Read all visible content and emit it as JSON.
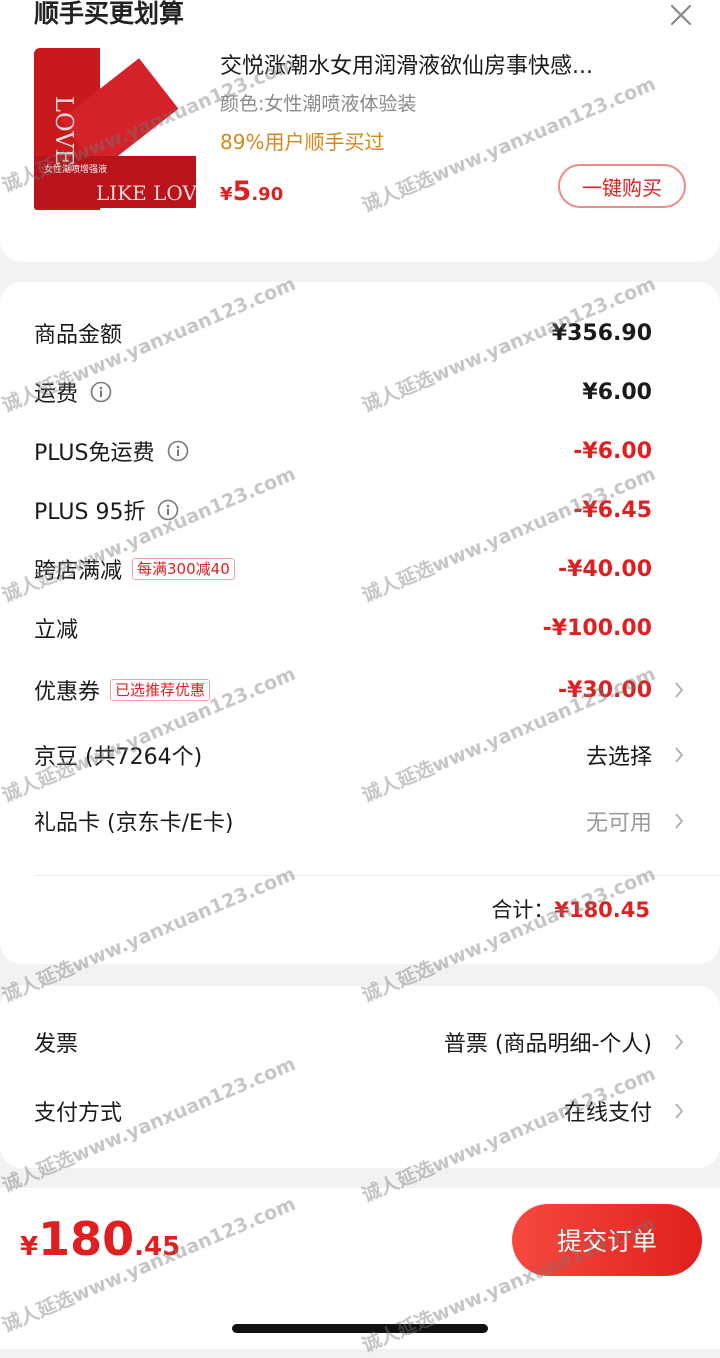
{
  "upsell": {
    "section_title": "顺手买更划算",
    "product": {
      "title": "交悦涨潮水女用润滑液欲仙房事快感...",
      "spec": "颜色:女性潮喷液体验装",
      "bought": "89%用户顺手买过",
      "price_currency": "¥",
      "price_int": "5",
      "price_dec": ".90",
      "image_text_main": "LIKE LOVE",
      "image_text_small": "女性潮喷增强液"
    },
    "buy_label": "一键购买"
  },
  "summary": {
    "rows": [
      {
        "label": "商品金额",
        "value": "¥356.90"
      },
      {
        "label": "运费",
        "value": "¥6.00"
      },
      {
        "label": "PLUS免运费",
        "value": "-¥6.00"
      },
      {
        "label": "PLUS 95折",
        "value": "-¥6.45"
      },
      {
        "label": "跨店满减",
        "tag": "每满300减40",
        "value": "-¥40.00"
      },
      {
        "label": "立减",
        "value": "-¥100.00"
      },
      {
        "label": "优惠券",
        "tag": "已选推荐优惠",
        "value": "-¥30.00"
      },
      {
        "label": "京豆 (共7264个)",
        "value": "去选择"
      },
      {
        "label": "礼品卡 (京东卡/E卡)",
        "value": "无可用"
      }
    ],
    "total_label": "合计：",
    "total_value": "¥180.45"
  },
  "misc": {
    "rows": [
      {
        "label": "发票",
        "value": "普票 (商品明细-个人)"
      },
      {
        "label": "支付方式",
        "value": "在线支付"
      }
    ]
  },
  "bottom": {
    "currency": "¥",
    "price_int": "180",
    "price_dec": ".45",
    "submit_label": "提交订单"
  },
  "watermark": "诚人延选www.yanxuan123.com",
  "colors": {
    "accent": "#e02020",
    "orange": "#d6861b",
    "muted": "#9a9a9a"
  }
}
